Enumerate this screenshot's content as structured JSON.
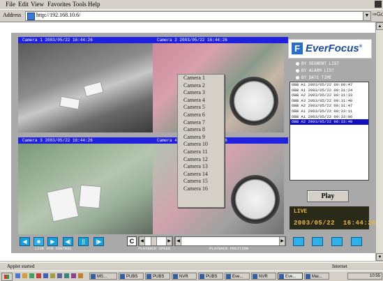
{
  "menu": [
    "File",
    "Edit",
    "View",
    "Favorites",
    "Tools",
    "Help"
  ],
  "address": {
    "label": "Address",
    "url": "http://192.168.10.6/"
  },
  "cameras": [
    {
      "title": "Camera 1  2003/05/22 16:44:26"
    },
    {
      "title": "Camera 2  2003/05/22 16:44:26"
    },
    {
      "title": "Camera 3  2003/05/22 16:44:26"
    },
    {
      "title": "Camera 4  2003/05/22 16:44:26"
    }
  ],
  "camera_menu": [
    "Camera 1",
    "Camera 2",
    "Camera 3",
    "Camera 4",
    "Camera 5",
    "Camera 6",
    "Camera 7",
    "Camera 8",
    "Camera 9",
    "Camera 10",
    "Camera 11",
    "Camera 12",
    "Camera 13",
    "Camera 14",
    "Camera 15",
    "Camera 16"
  ],
  "brand": {
    "mark": "F",
    "name": "EverFocus",
    "reg": "®"
  },
  "search_options": [
    "BY SEGMENT LIST",
    "BY ALARM LIST",
    "BY DATE TIME"
  ],
  "log": [
    {
      "text": "OBB  A1 2003/05/22 09:09:47",
      "selected": false
    },
    {
      "text": "OBB  A1 2003/05/22 09:31:24",
      "selected": false
    },
    {
      "text": "OBB  A2 2003/05/22 09:31:33",
      "selected": false
    },
    {
      "text": "OBB  A3 2003/05/22 09:31:40",
      "selected": false
    },
    {
      "text": "OBB  A2 2003/05/22 09:31:47",
      "selected": false
    },
    {
      "text": "OBB  A1 2003/05/22 09:33:11",
      "selected": false
    },
    {
      "text": "OBB  A1 2003/05/22 09:33:06",
      "selected": false
    },
    {
      "text": "OBB  A2 2003/05/22 09:33:40",
      "selected": true
    }
  ],
  "play_label": "Play",
  "lcd": {
    "mode": "LIVE",
    "date": "2003/05/22",
    "time": "16:44:26"
  },
  "controls": {
    "live_vcr": "LIVE VCR CONTROL",
    "playback_speed": "PLAYBACK SPEED",
    "playback_position": "PLAYBACK POSITION",
    "c_label": "C"
  },
  "status": {
    "text": "Applet started",
    "zone": "Internet"
  },
  "taskbar": {
    "buttons": [
      "MS...",
      "PUBS",
      "PUBS",
      "NVR",
      "PUBS",
      "Eve...",
      "NVR",
      "Eve...",
      "Mai..."
    ],
    "clock": "10:55"
  },
  "colors": {
    "camera_title_bar": "#2020e0",
    "selected_row": "#1010c0",
    "control_button": "#1a9fd8",
    "lcd_text": "#e8b54a"
  }
}
